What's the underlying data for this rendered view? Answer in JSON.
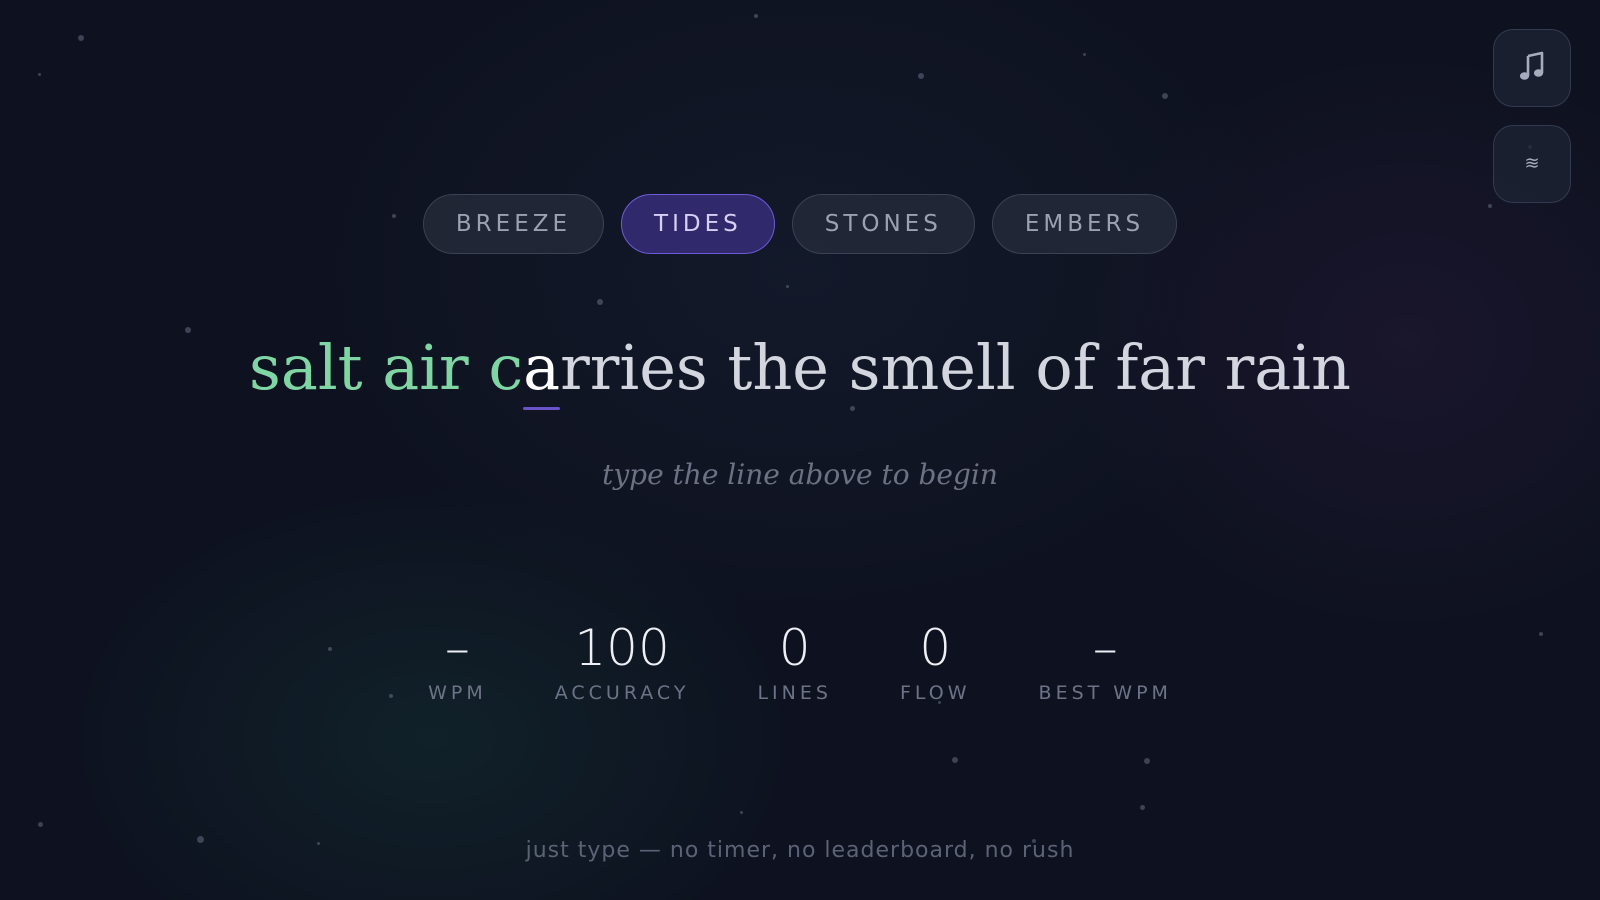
{
  "controls": {
    "music_icon": "music-note-icon",
    "ambient_icon": "waves-icon",
    "ambient_glyph": "≋"
  },
  "tabs": [
    {
      "label": "BREEZE",
      "active": false
    },
    {
      "label": "TIDES",
      "active": true
    },
    {
      "label": "STONES",
      "active": false
    },
    {
      "label": "EMBERS",
      "active": false
    }
  ],
  "prompt": {
    "typed": "salt air c",
    "current": "a",
    "remaining": "rries the smell of far rain"
  },
  "hint": "type the line above to begin",
  "stats": [
    {
      "value": "–",
      "label": "WPM"
    },
    {
      "value": "100",
      "label": "ACCURACY"
    },
    {
      "value": "0",
      "label": "LINES"
    },
    {
      "value": "0",
      "label": "FLOW"
    },
    {
      "value": "–",
      "label": "BEST WPM"
    }
  ],
  "footer": "just type — no timer, no leaderboard, no rush",
  "colors": {
    "background": "#0e1220",
    "typed": "#7fd6a3",
    "current": "#ffffff",
    "remaining": "#d3d6df",
    "active_tab_bg": "#302a6c",
    "active_tab_border": "#6d5ad6",
    "cursor": "#6a52c8"
  }
}
